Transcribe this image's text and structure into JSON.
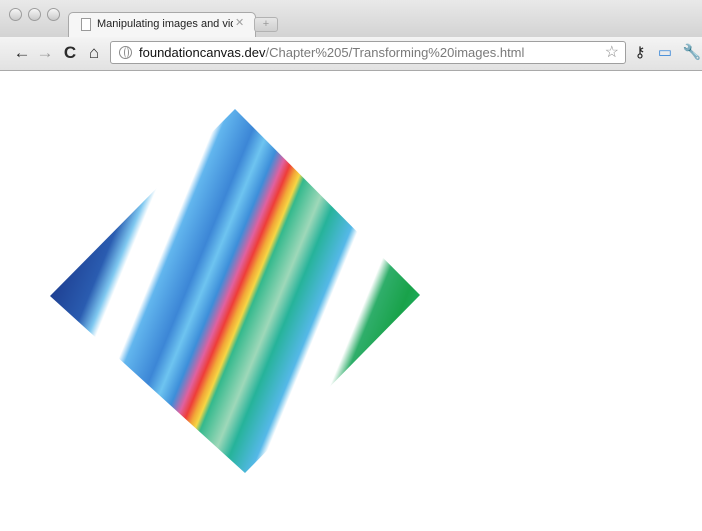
{
  "browser": {
    "window_buttons": [
      "close",
      "minimize",
      "zoom"
    ],
    "tab": {
      "title": "Manipulating images and vid",
      "close_glyph": "✕"
    },
    "new_tab_glyph": "+",
    "toolbar": {
      "back_glyph": "←",
      "forward_glyph": "→",
      "reload_glyph": "C",
      "home_glyph": "⌂",
      "url_host": "foundationcanvas.dev",
      "url_path": "/Chapter%205/Transforming%20images.html",
      "star_glyph": "☆",
      "key_glyph": "⚷",
      "page_glyph": "▭",
      "wrench_glyph": "🔧"
    },
    "icons": [
      "close-window-icon",
      "minimize-window-icon",
      "zoom-window-icon",
      "page-icon",
      "globe-icon",
      "bookmark-star-icon",
      "key-icon",
      "page-menu-icon",
      "wrench-icon"
    ]
  },
  "content": {
    "image": {
      "description_colors": [
        "#1f3f8f",
        "#3f8ed8",
        "#ffffff",
        "#e8453a",
        "#f2b233",
        "#25b59a",
        "#21a85a"
      ]
    }
  }
}
